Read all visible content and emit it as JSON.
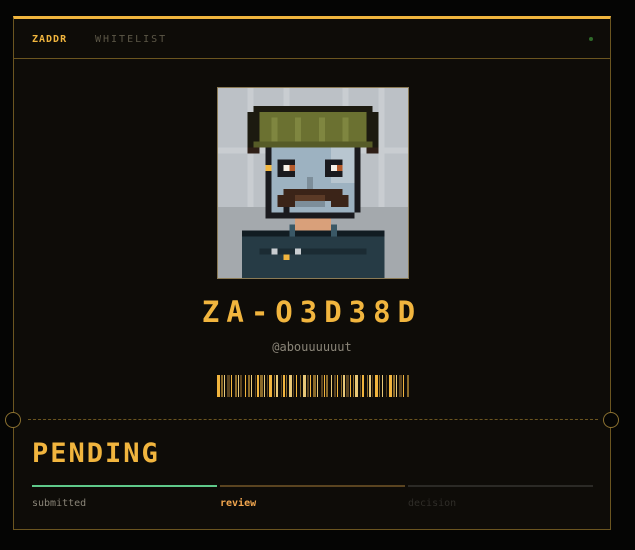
{
  "header": {
    "brand": "ZADDR",
    "nav_link": "WHITELIST",
    "status_dot_color": "#2f6a2a"
  },
  "profile": {
    "avatar_alt": "pixel avatar",
    "token_id": "ZA-O3D38D",
    "handle": "@abouuuuuut"
  },
  "status": {
    "title": "PENDING",
    "steps": [
      {
        "label": "submitted",
        "state": "complete",
        "color": "#5fc98a"
      },
      {
        "label": "review",
        "state": "active",
        "color": "#f1a64e"
      },
      {
        "label": "decision",
        "state": "upcoming",
        "color": "#2f2d28"
      }
    ]
  },
  "colors": {
    "accent": "#f1b53e",
    "border": "#6b5520",
    "background": "#0e0c08"
  }
}
